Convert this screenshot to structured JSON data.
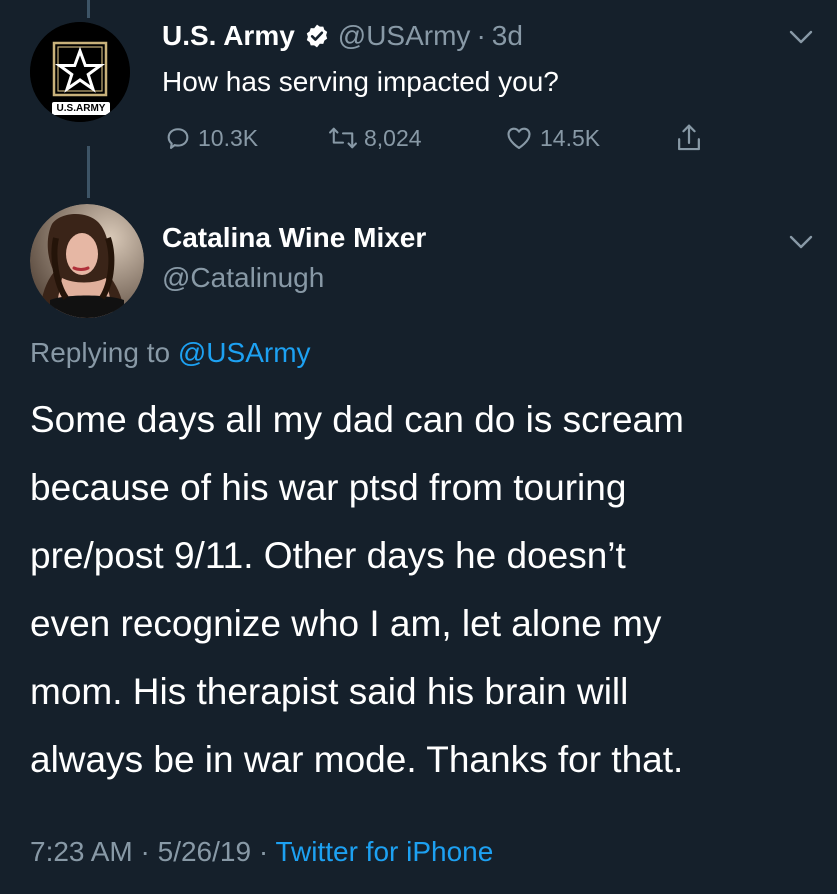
{
  "tweet": {
    "author_name": "U.S. Army",
    "author_handle": "@USArmy",
    "separator": "·",
    "age": "3d",
    "text": "How has serving impacted you?",
    "avatar_badge": "U.S.ARMY",
    "replies": "10.3K",
    "retweets": "8,024",
    "likes": "14.5K"
  },
  "reply": {
    "author_name": "Catalina Wine Mixer",
    "author_handle": "@Catalinugh",
    "replying_prefix": "Replying to",
    "replying_to": "@USArmy",
    "lines": [
      "Some days all my dad can do is scream",
      "because of his war ptsd from touring",
      "pre/post 9/11. Other days he doesn’t",
      "even recognize who I am, let alone my",
      "mom. His therapist said his brain will",
      "always be in war mode. Thanks for that."
    ],
    "time": "7:23 AM",
    "date": "5/26/19",
    "dot": "·",
    "source": "Twitter for iPhone"
  },
  "colors": {
    "background": "#15202b",
    "text": "#ffffff",
    "muted": "#8899a6",
    "link": "#1da1f2",
    "thread_line": "#3d5466"
  }
}
